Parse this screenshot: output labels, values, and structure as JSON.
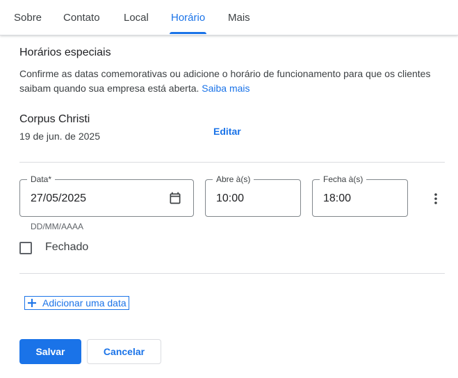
{
  "tabs": [
    {
      "label": "Sobre",
      "active": false
    },
    {
      "label": "Contato",
      "active": false
    },
    {
      "label": "Local",
      "active": false
    },
    {
      "label": "Horário",
      "active": true
    },
    {
      "label": "Mais",
      "active": false
    }
  ],
  "section": {
    "title": "Horários especiais",
    "description": "Confirme as datas comemorativas ou adicione o horário de funcionamento para que os clientes saibam quando sua empresa está aberta.",
    "learn_more": "Saiba mais"
  },
  "holiday": {
    "name": "Corpus Christi",
    "date": "19 de jun. de 2025",
    "edit_label": "Editar"
  },
  "form": {
    "date_label": "Data*",
    "date_value": "27/05/2025",
    "date_hint": "DD/MM/AAAA",
    "opens_label": "Abre à(s)",
    "opens_value": "10:00",
    "closes_label": "Fecha à(s)",
    "closes_value": "18:00",
    "closed_label": "Fechado",
    "closed_checked": false
  },
  "add_date_label": "Adicionar uma data",
  "actions": {
    "save": "Salvar",
    "cancel": "Cancelar"
  },
  "icons": {
    "calendar": "calendar-icon",
    "more": "more-vert-icon",
    "plus": "plus-icon"
  },
  "colors": {
    "accent": "#1a73e8",
    "text": "#202124",
    "divider": "#dadce0"
  }
}
